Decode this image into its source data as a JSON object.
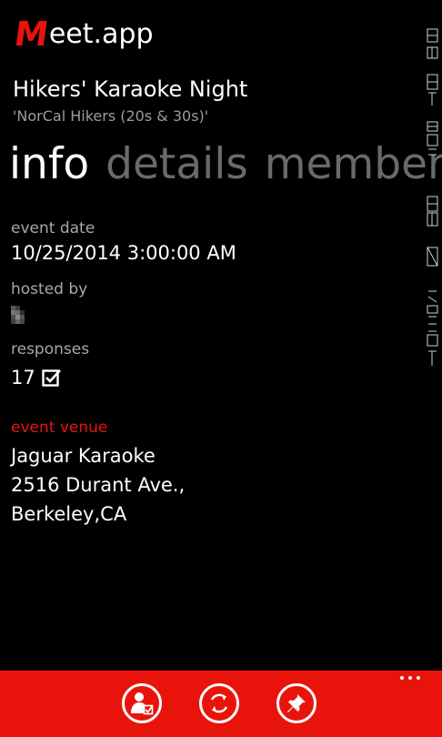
{
  "app": {
    "logo_letter": "M",
    "logo_rest": "eet.app",
    "accent_color": "#e8140c"
  },
  "event": {
    "title": "Hikers' Karaoke Night",
    "group": "'NorCal Hikers (20s & 30s)'"
  },
  "pivot": {
    "tabs": [
      "info",
      "details",
      "members"
    ],
    "active_tab": "info"
  },
  "info": {
    "date_label": "event date",
    "date_value": "10/25/2014 3:00:00 AM",
    "hosted_label": "hosted by",
    "responses_label": "responses",
    "responses_count": "17",
    "venue_label": "event venue",
    "venue_name": "Jaguar Karaoke",
    "venue_street": "2516 Durant Ave.,",
    "venue_city": "Berkeley,CA"
  },
  "app_bar": {
    "buttons": [
      {
        "icon": "person-check-icon"
      },
      {
        "icon": "refresh-icon"
      },
      {
        "icon": "pin-icon"
      }
    ],
    "more_icon": "more-dots-icon"
  }
}
